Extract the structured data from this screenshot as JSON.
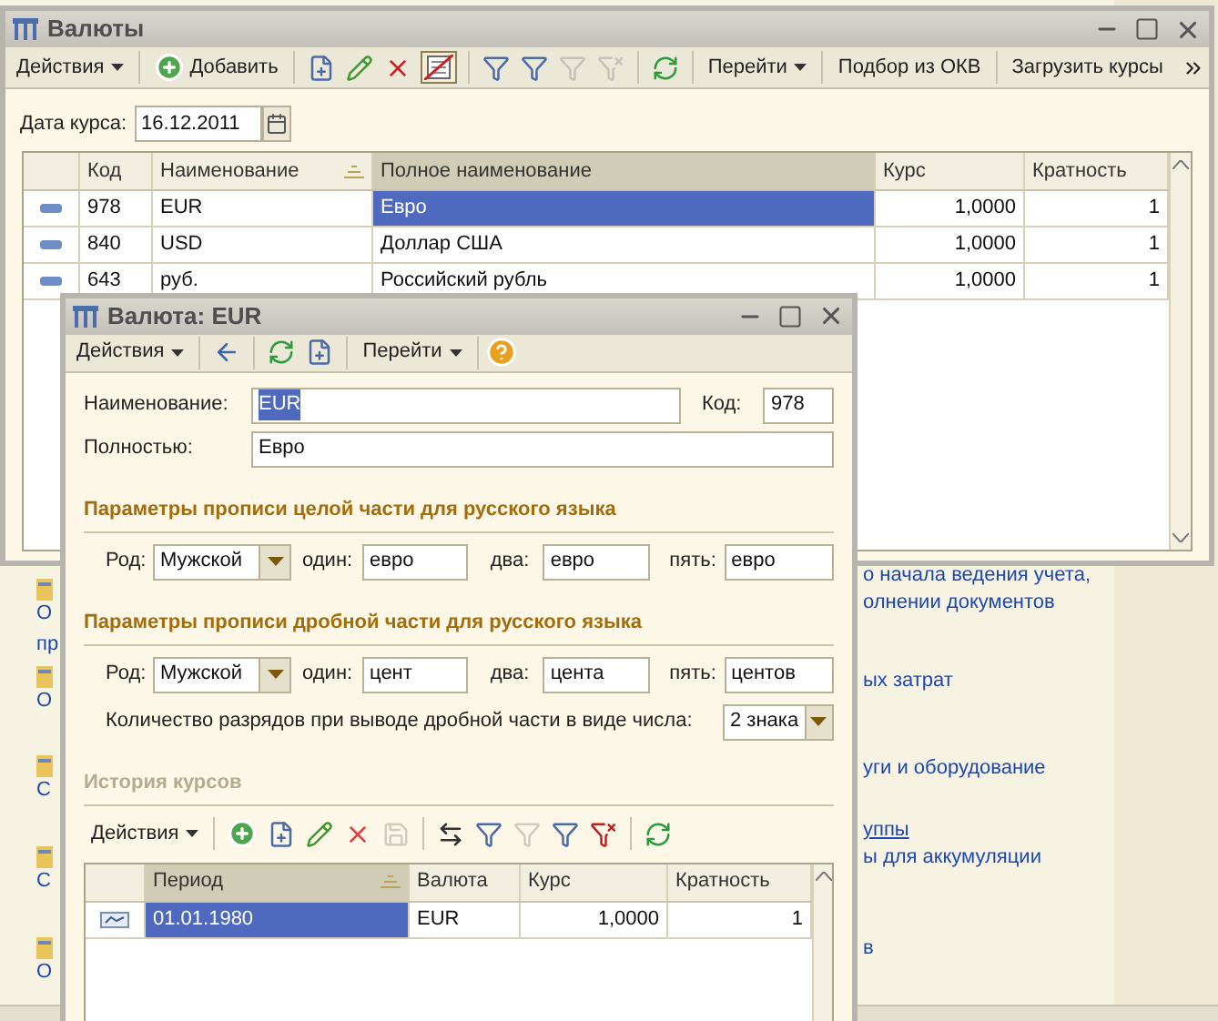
{
  "background": {
    "left_items": [
      {
        "kind": "link",
        "text": "О"
      },
      {
        "kind": "wrap",
        "text": "пр"
      },
      {
        "kind": "link",
        "text": "О"
      },
      {
        "kind": "link",
        "text": "С"
      },
      {
        "kind": "link",
        "text": "С"
      },
      {
        "kind": "link",
        "text": "О"
      }
    ],
    "right_links": [
      {
        "text": "о начала ведения учета,",
        "underlined": false
      },
      {
        "text": "олнении документов",
        "underlined": false
      },
      {
        "text": "ых затрат",
        "underlined": false
      },
      {
        "text": "уги и оборудование",
        "underlined": false
      },
      {
        "text": "уппы",
        "underlined": true
      },
      {
        "text": "ы для аккумуляции",
        "underlined": false
      },
      {
        "text": "в",
        "underlined": false
      }
    ]
  },
  "main_window": {
    "title": "Валюты",
    "toolbar": {
      "actions": "Действия",
      "add": "Добавить",
      "goto": "Перейти",
      "buttons": [
        "Подбор из ОКВ",
        "Загрузить курсы"
      ]
    },
    "date_label": "Дата курса:",
    "date_value": "16.12.2011",
    "table": {
      "columns": [
        {
          "label": "Код",
          "active": false,
          "sorted": false,
          "numeric": false
        },
        {
          "label": "Наименование",
          "active": false,
          "sorted": true,
          "numeric": false
        },
        {
          "label": "Полное наименование",
          "active": true,
          "sorted": false,
          "numeric": false
        },
        {
          "label": "Курс",
          "active": false,
          "sorted": false,
          "numeric": true
        },
        {
          "label": "Кратность",
          "active": false,
          "sorted": false,
          "numeric": true
        }
      ],
      "rows": [
        {
          "cells": [
            "978",
            "EUR",
            "Евро",
            "1,0000",
            "1"
          ],
          "selected": true
        },
        {
          "cells": [
            "840",
            "USD",
            "Доллар США",
            "1,0000",
            "1"
          ],
          "selected": false
        },
        {
          "cells": [
            "643",
            "руб.",
            "Российский рубль",
            "1,0000",
            "1"
          ],
          "selected": false
        }
      ]
    }
  },
  "dialog": {
    "title": "Валюта: EUR",
    "toolbar": {
      "actions": "Действия",
      "goto": "Перейти"
    },
    "name_label": "Наименование:",
    "name_value": "EUR",
    "code_label": "Код:",
    "code_value": "978",
    "full_label": "Полностью:",
    "full_value": "Евро",
    "sections": [
      {
        "title": "Параметры прописи целой части для русского языка",
        "disabled": false,
        "gender_label": "Род:",
        "gender": "Мужской",
        "one_label": "один:",
        "one": "евро",
        "two_label": "два:",
        "two": "евро",
        "five_label": "пять:",
        "five": "евро"
      },
      {
        "title": "Параметры прописи дробной части для русского языка",
        "disabled": false,
        "gender_label": "Род:",
        "gender": "Мужской",
        "one_label": "один:",
        "one": "цент",
        "two_label": "два:",
        "two": "цента",
        "five_label": "пять:",
        "five": "центов"
      }
    ],
    "digits_label": "Количество разрядов при выводе дробной части в виде числа:",
    "digits_value": "2 знака",
    "history": {
      "title": "История курсов",
      "disabled": true,
      "actions": "Действия",
      "columns": [
        {
          "label": "Период",
          "active": true,
          "sorted": true,
          "numeric": false
        },
        {
          "label": "Валюта",
          "active": false,
          "sorted": false,
          "numeric": false
        },
        {
          "label": "Курс",
          "active": false,
          "sorted": false,
          "numeric": true
        },
        {
          "label": "Кратность",
          "active": false,
          "sorted": false,
          "numeric": true
        }
      ],
      "rows": [
        {
          "cells": [
            "01.01.1980",
            "EUR",
            "1,0000",
            "1"
          ],
          "selected": true
        }
      ]
    }
  }
}
